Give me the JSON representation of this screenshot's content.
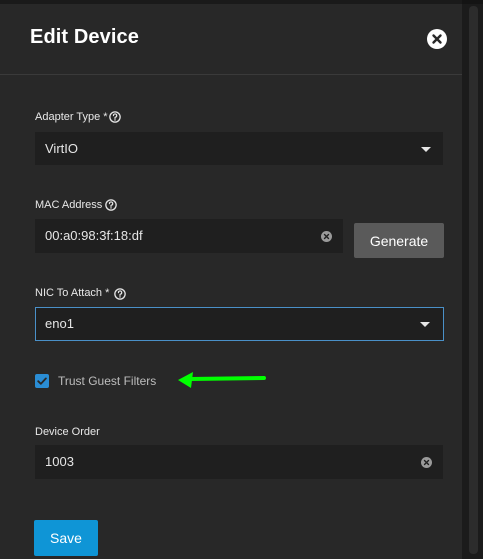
{
  "dialog": {
    "title": "Edit Device",
    "close_icon": "close-icon"
  },
  "fields": {
    "adapter_type": {
      "label": "Adapter Type *",
      "value": "VirtIO"
    },
    "mac_address": {
      "label": "MAC Address",
      "value": "00:a0:98:3f:18:df",
      "generate_label": "Generate"
    },
    "nic_to_attach": {
      "label": "NIC To Attach *",
      "value": "eno1"
    },
    "trust_guest_filters": {
      "label": "Trust Guest Filters",
      "checked": true
    },
    "device_order": {
      "label": "Device Order",
      "value": "1003"
    }
  },
  "actions": {
    "save_label": "Save"
  },
  "colors": {
    "panel_bg": "#282828",
    "field_bg": "#1f1f1f",
    "primary": "#0f95d6",
    "focus_border": "#4a90c8",
    "annotation_arrow": "#00ff00"
  }
}
